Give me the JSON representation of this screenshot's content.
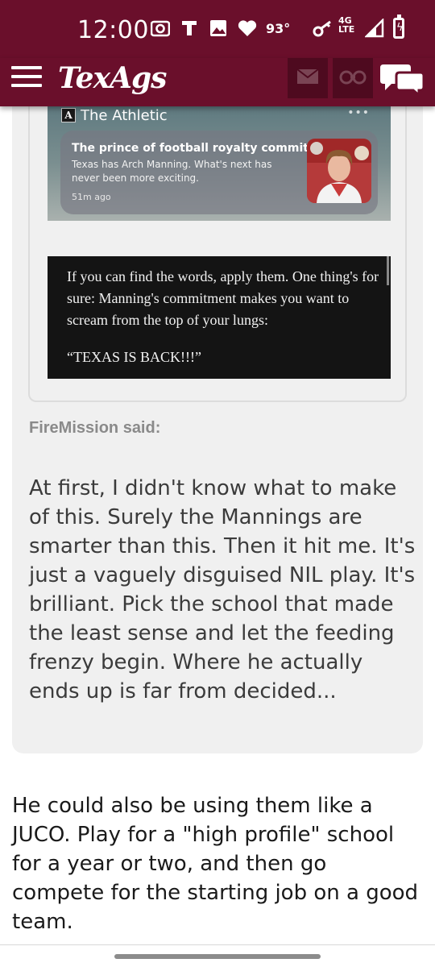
{
  "status_bar": {
    "time": "12:00",
    "icons": [
      "camera-icon",
      "t-mobile-icon",
      "image-icon",
      "heart-icon"
    ],
    "temperature": "93°",
    "network": "4G LTE",
    "network_icons": [
      "key-icon",
      "signal-icon",
      "battery-charging-icon"
    ]
  },
  "header": {
    "logo": "TexAgs",
    "buttons": [
      "mail-icon",
      "binoculars-icon",
      "chat-bubbles-icon"
    ],
    "colors": {
      "brand": "#6a0f2b",
      "button_bg": "#4e0a1f"
    }
  },
  "embed": {
    "notification": {
      "source": "The Athletic",
      "source_logo": "A",
      "title": "The prince of football royalty commits",
      "body": "Texas has Arch Manning. What's next has never been more exciting.",
      "time": "51m ago"
    },
    "excerpt": {
      "paragraph1": "If you can find the words, apply them. One thing's for sure: Manning's commitment makes you want to scream from the top of your lungs:",
      "paragraph2": "“TEXAS IS BACK!!!”"
    }
  },
  "quote": {
    "author_line": "FireMission said:",
    "text": "At first, I didn't know what to make of this. Surely the Mannings are smarter than this. Then it hit me. It's just a vaguely disguised NIL play. It's brilliant. Pick the school that made the least sense and let the feeding frenzy begin. Where he actually ends up is far from decided..."
  },
  "post": {
    "text": "He could also be using them like a JUCO. Play for a \"high profile\" school for a year or two, and then go compete for the starting job on a good team."
  }
}
